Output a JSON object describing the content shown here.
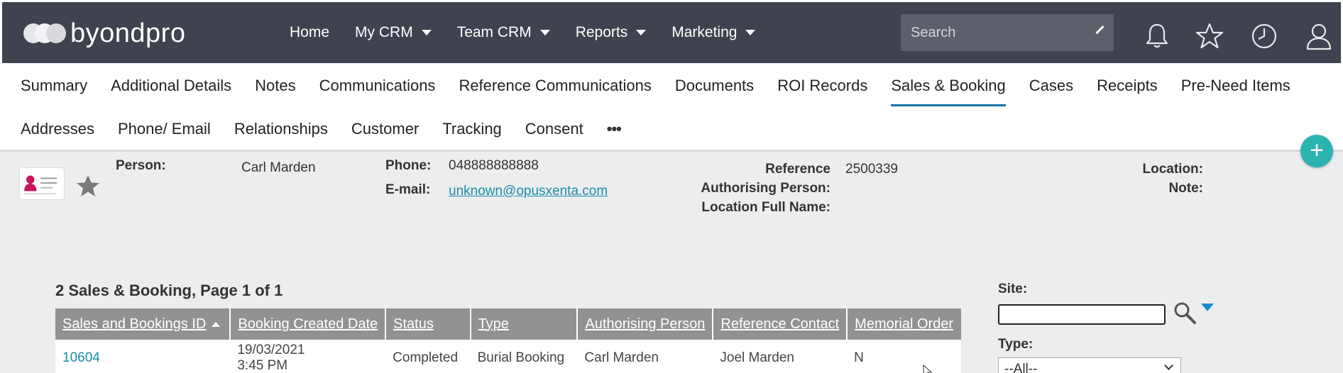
{
  "app": {
    "logo_text": "byondpro"
  },
  "topnav": {
    "items": [
      "Home",
      "My CRM",
      "Team CRM",
      "Reports",
      "Marketing"
    ]
  },
  "search": {
    "placeholder": "Search"
  },
  "tabs": {
    "row1": [
      "Summary",
      "Additional Details",
      "Notes",
      "Communications",
      "Reference Communications",
      "Documents",
      "ROI Records",
      "Sales & Booking",
      "Cases",
      "Receipts",
      "Pre-Need Items"
    ],
    "row2": [
      "Addresses",
      "Phone/ Email",
      "Relationships",
      "Customer",
      "Tracking",
      "Consent"
    ],
    "active": "Sales & Booking",
    "more": "•••"
  },
  "record": {
    "person_label": "Person:",
    "person_value": "Carl Marden",
    "phone_label": "Phone:",
    "phone_value": "048888888888",
    "email_label": "E-mail:",
    "email_value": "unknown@opusxenta.com",
    "reference_label": "Reference",
    "reference_value": "2500339",
    "authorising_label": "Authorising Person:",
    "location_full_label": "Location Full Name:",
    "location_label": "Location:",
    "note_label": "Note:"
  },
  "grid": {
    "title": "2 Sales & Booking, Page 1 of 1",
    "columns": [
      "Sales and Bookings ID",
      "Booking Created Date",
      "Status",
      "Type",
      "Authorising Person",
      "Reference Contact",
      "Memorial Order"
    ],
    "rows": [
      {
        "id": "10604",
        "date_line1": "19/03/2021",
        "date_line2": "3:45 PM",
        "status": "Completed",
        "type": "Burial Booking",
        "authorising": "Carl Marden",
        "reference_contact": "Joel Marden",
        "memorial_order": "N"
      }
    ]
  },
  "filters": {
    "site_label": "Site:",
    "site_value": "",
    "type_label": "Type:",
    "type_value": "--All--"
  },
  "colors": {
    "topbar": "#3e434f",
    "accent_link": "#1a8ca8",
    "fab": "#2bb3b0",
    "header_grey": "#929292"
  }
}
